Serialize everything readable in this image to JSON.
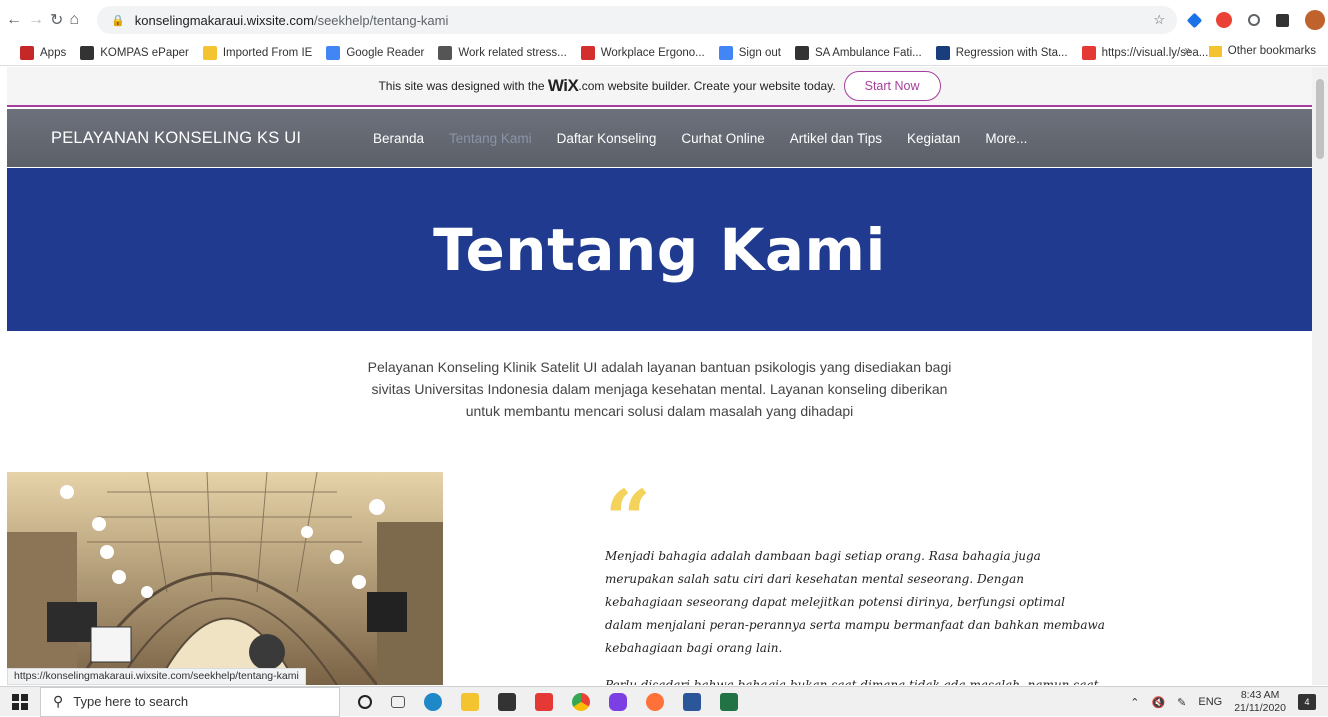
{
  "browser": {
    "url_host": "konselingmakaraui.wixsite.com",
    "url_path": "/seekhelp/tentang-kami",
    "bookmarks": [
      "Apps",
      "KOMPAS ePaper",
      "Imported From IE",
      "Google Reader",
      "Work related stress...",
      "Workplace Ergono...",
      "Sign out",
      "SA Ambulance Fati...",
      "Regression with Sta...",
      "https://visual.ly/sea..."
    ],
    "bookmark_overflow": "»",
    "other_bookmarks": "Other bookmarks",
    "status_url": "https://konselingmakaraui.wixsite.com/seekhelp/tentang-kami"
  },
  "wix_banner": {
    "text_before": "This site was designed with the",
    "logo": "WiX",
    "text_after": ".com website builder. Create your website today.",
    "cta": "Start Now"
  },
  "site": {
    "brand": "PELAYANAN KONSELING KS UI",
    "menu": [
      "Beranda",
      "Tentang Kami",
      "Daftar Konseling",
      "Curhat Online",
      "Artikel dan Tips",
      "Kegiatan",
      "More..."
    ],
    "active_menu": "Tentang Kami",
    "hero_title": "Tentang Kami",
    "intro": "Pelayanan Konseling Klinik Satelit UI adalah layanan bantuan psikologis yang disediakan bagi sivitas Universitas Indonesia dalam menjaga kesehatan mental. Layanan konseling diberikan untuk membantu mencari solusi dalam masalah yang dihadapi",
    "quote_mark": "“",
    "quote_p1": "Menjadi bahagia adalah dambaan bagi setiap orang. Rasa bahagia juga merupakan salah satu ciri dari kesehatan mental seseorang. Dengan kebahagiaan seseorang dapat melejitkan potensi dirinya, berfungsi optimal dalam menjalani peran-perannya serta mampu bermanfaat dan bahkan membawa kebahagiaan bagi orang lain.",
    "quote_p2": "Perlu disadari bahwa bahagia bukan saat dimana tidak ada masalah, namun saat"
  },
  "taskbar": {
    "search_placeholder": "Type here to search",
    "lang": "ENG",
    "time": "8:43 AM",
    "date": "21/11/2020",
    "notifications": "4"
  },
  "colors": {
    "hero_bg": "#1f3a8f",
    "nav_bg": "#5f636c",
    "wix_accent": "#a53f9c",
    "quote_mark": "#f3d35c"
  }
}
